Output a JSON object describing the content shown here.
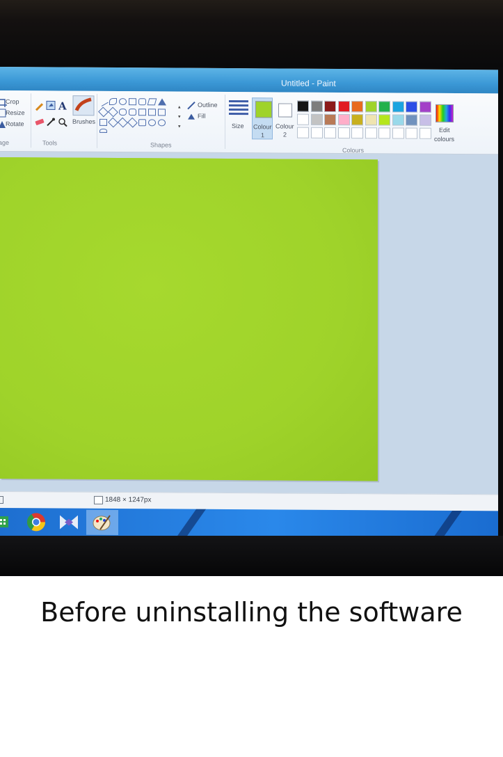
{
  "window": {
    "title": "Untitled - Paint"
  },
  "ribbon": {
    "image_group": {
      "crop_label": "Crop",
      "resize_label": "Resize",
      "rotate_label": "Rotate",
      "group_label": "age"
    },
    "tools_group": {
      "brushes_label": "Brushes",
      "group_label": "Tools",
      "icons": [
        "pencil-icon",
        "fill-bucket-icon",
        "text-icon",
        "eraser-icon",
        "colour-picker-icon",
        "magnifier-icon",
        "brush-icon"
      ]
    },
    "shapes_group": {
      "outline_label": "Outline",
      "fill_label": "Fill",
      "group_label": "Shapes"
    },
    "size_label": "Size",
    "colour1": {
      "label": "Colour",
      "number": "1",
      "value": "#9fd32a"
    },
    "colour2": {
      "label": "Colour",
      "number": "2",
      "value": "#ffffff"
    },
    "colours_group": {
      "group_label": "Colours",
      "edit_label_line1": "Edit",
      "edit_label_line2": "colours",
      "palette_row1": [
        "#151515",
        "#7d7d7d",
        "#8b1a1a",
        "#e11c24",
        "#e86a1f",
        "#9fd32a",
        "#22b14c",
        "#1aa4e0",
        "#2b4ee6",
        "#a340c8"
      ],
      "palette_row2": [
        "#ffffff",
        "#c3c3c3",
        "#b97a57",
        "#ffaec9",
        "#c8b01e",
        "#efe4b0",
        "#b5e61d",
        "#99d9ea",
        "#7092be",
        "#c8bfe7"
      ],
      "palette_row3": [
        "#ffffff",
        "#ffffff",
        "#ffffff",
        "#ffffff",
        "#ffffff",
        "#ffffff",
        "#ffffff",
        "#ffffff",
        "#ffffff",
        "#ffffff"
      ]
    }
  },
  "canvas": {
    "fill_colour": "#9fd32a"
  },
  "status": {
    "dimensions": "1848 × 1247px"
  },
  "taskbar": {
    "items": [
      {
        "name": "store-icon"
      },
      {
        "name": "chrome-icon"
      },
      {
        "name": "visual-studio-icon"
      },
      {
        "name": "paint-icon"
      }
    ]
  },
  "caption": "Before uninstalling the software"
}
